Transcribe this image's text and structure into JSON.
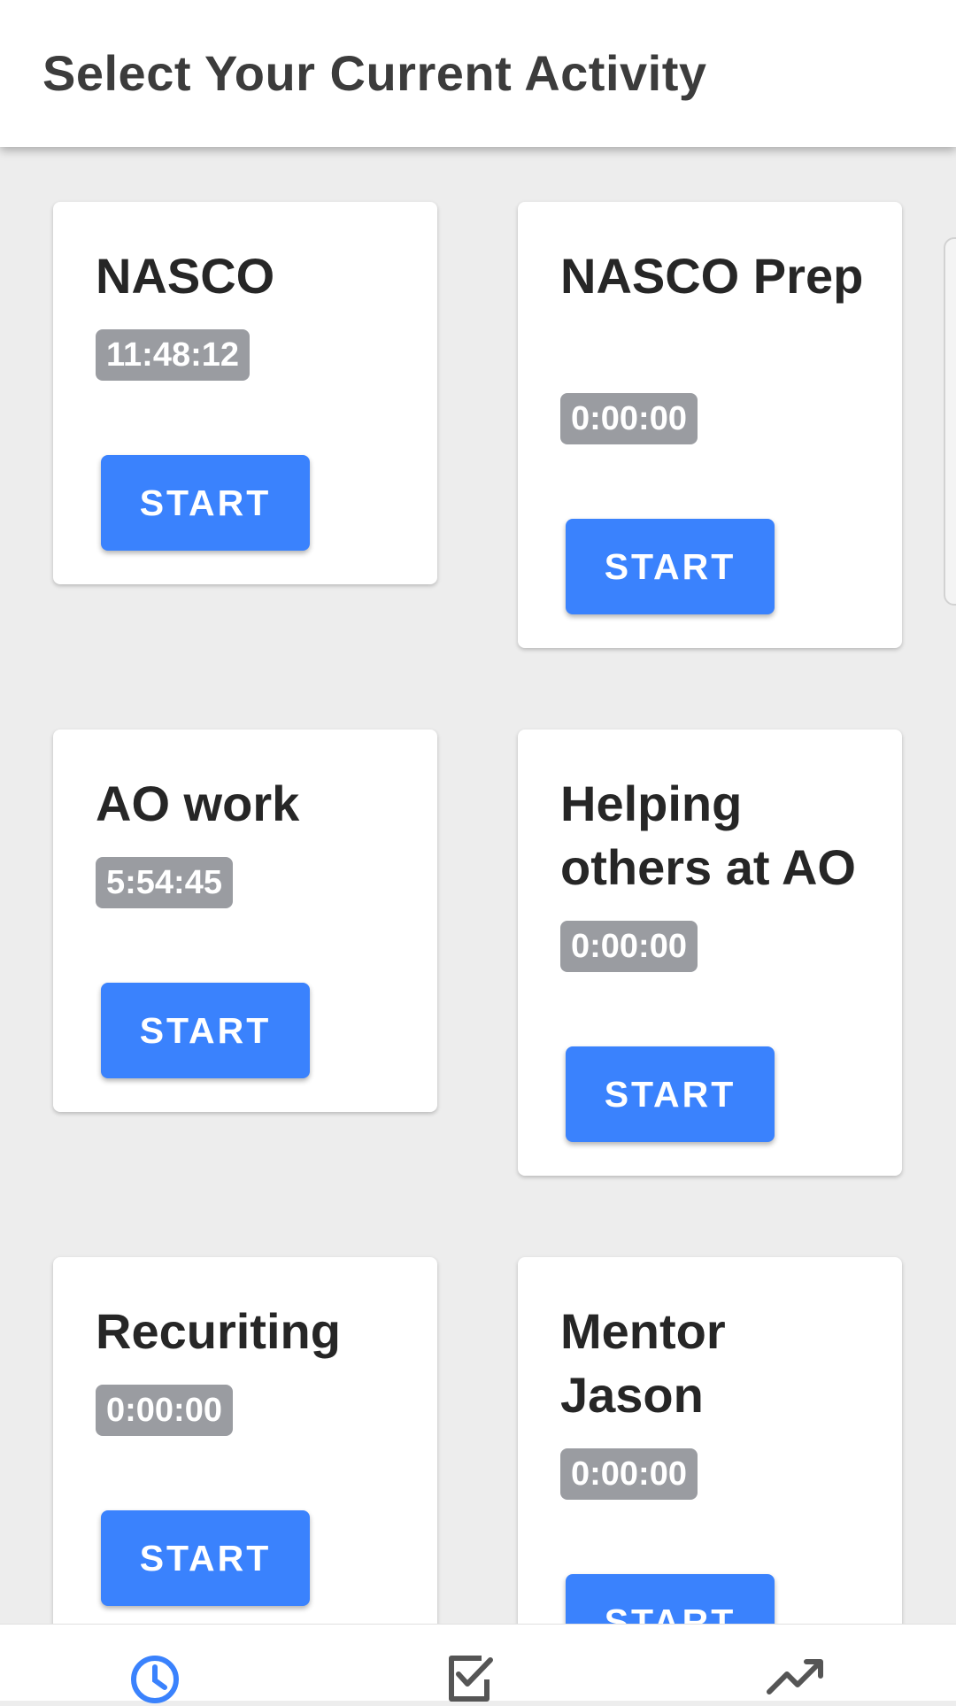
{
  "header": {
    "title": "Select Your Current Activity"
  },
  "activities": [
    {
      "name": "NASCO",
      "time": "11:48:12",
      "button": "START"
    },
    {
      "name": "NASCO Prep",
      "time": "0:00:00",
      "button": "START"
    },
    {
      "name": "AO work",
      "time": "5:54:45",
      "button": "START"
    },
    {
      "name": "Helping others at AO",
      "time": "0:00:00",
      "button": "START"
    },
    {
      "name": "Recuriting",
      "time": "0:00:00",
      "button": "START"
    },
    {
      "name": "Mentor Jason",
      "time": "0:00:00",
      "button": "START"
    }
  ],
  "bottom_nav": {
    "items": [
      {
        "icon": "clock-icon",
        "active": true
      },
      {
        "icon": "checkbox-icon",
        "active": false
      },
      {
        "icon": "trending-up-icon",
        "active": false
      }
    ],
    "active_color": "#3a82fd",
    "inactive_color": "#555555"
  },
  "colors": {
    "accent": "#3a82fd",
    "badge": "#9a9ca1",
    "background": "#ededed"
  }
}
